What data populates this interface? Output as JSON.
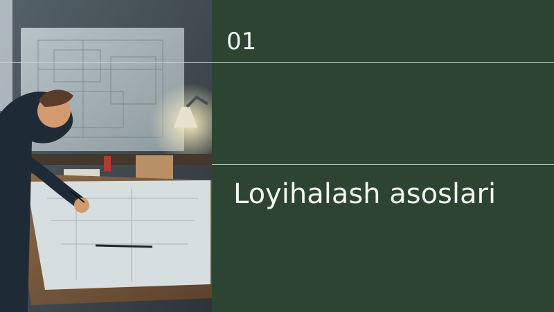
{
  "slide": {
    "number": "01",
    "title": "Loyihalash asoslari"
  },
  "photo": {
    "subject": "engineer-drafting-photo"
  },
  "colors": {
    "panel": "#2d4433",
    "rule": "#c9d2c9",
    "text": "#f3f5f1"
  }
}
